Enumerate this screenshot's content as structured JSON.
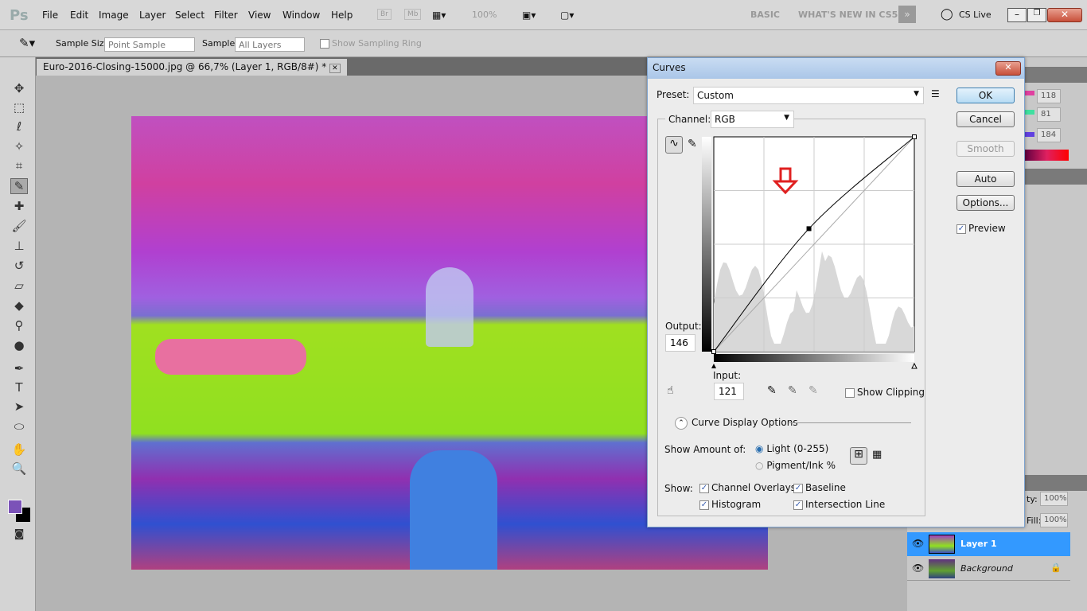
{
  "menubar": {
    "logo": "Ps",
    "items": [
      "File",
      "Edit",
      "Image",
      "Layer",
      "Select",
      "Filter",
      "View",
      "Window",
      "Help"
    ],
    "br": "Br",
    "mb": "Mb",
    "zoom": "100%",
    "workspaces": [
      "BASIC",
      "WHAT'S NEW IN CS5"
    ],
    "cslive": "CS Live"
  },
  "options": {
    "sample_size_label": "Sample Size:",
    "sample_size_value": "Point Sample",
    "sample_label": "Sample:",
    "sample_value": "All Layers",
    "show_ring": "Show Sampling Ring"
  },
  "document": {
    "tab": "Euro-2016-Closing-15000.jpg @ 66,7% (Layer 1, RGB/8#) *"
  },
  "curves": {
    "title": "Curves",
    "preset_label": "Preset:",
    "preset_value": "Custom",
    "channel_label": "Channel:",
    "channel_value": "RGB",
    "output_label": "Output:",
    "output_value": "146",
    "input_label": "Input:",
    "input_value": "121",
    "show_clipping": "Show Clipping",
    "display_options": "Curve Display Options",
    "show_amount_label": "Show Amount of:",
    "light": "Light  (0-255)",
    "pigment": "Pigment/Ink %",
    "show_label": "Show:",
    "channel_overlays": "Channel Overlays",
    "baseline": "Baseline",
    "histogram": "Histogram",
    "intersection_line": "Intersection Line",
    "buttons": {
      "ok": "OK",
      "cancel": "Cancel",
      "smooth": "Smooth",
      "auto": "Auto",
      "options": "Options..."
    },
    "preview": "Preview",
    "curve_points": [
      [
        0,
        0
      ],
      [
        121,
        146
      ],
      [
        255,
        255
      ]
    ],
    "annotation_color": "#e02020"
  },
  "color_panel": {
    "r": "118",
    "g": "81",
    "b": "184"
  },
  "layers": {
    "opacity_label": "ty:",
    "opacity": "100%",
    "fill_label": "Fill:",
    "fill": "100%",
    "items": [
      {
        "name": "Layer 1",
        "selected": true
      },
      {
        "name": "Background",
        "locked": true
      }
    ]
  },
  "colors": {
    "foreground": "#7b52b8",
    "background": "#000000",
    "accent": "#3399ff"
  }
}
